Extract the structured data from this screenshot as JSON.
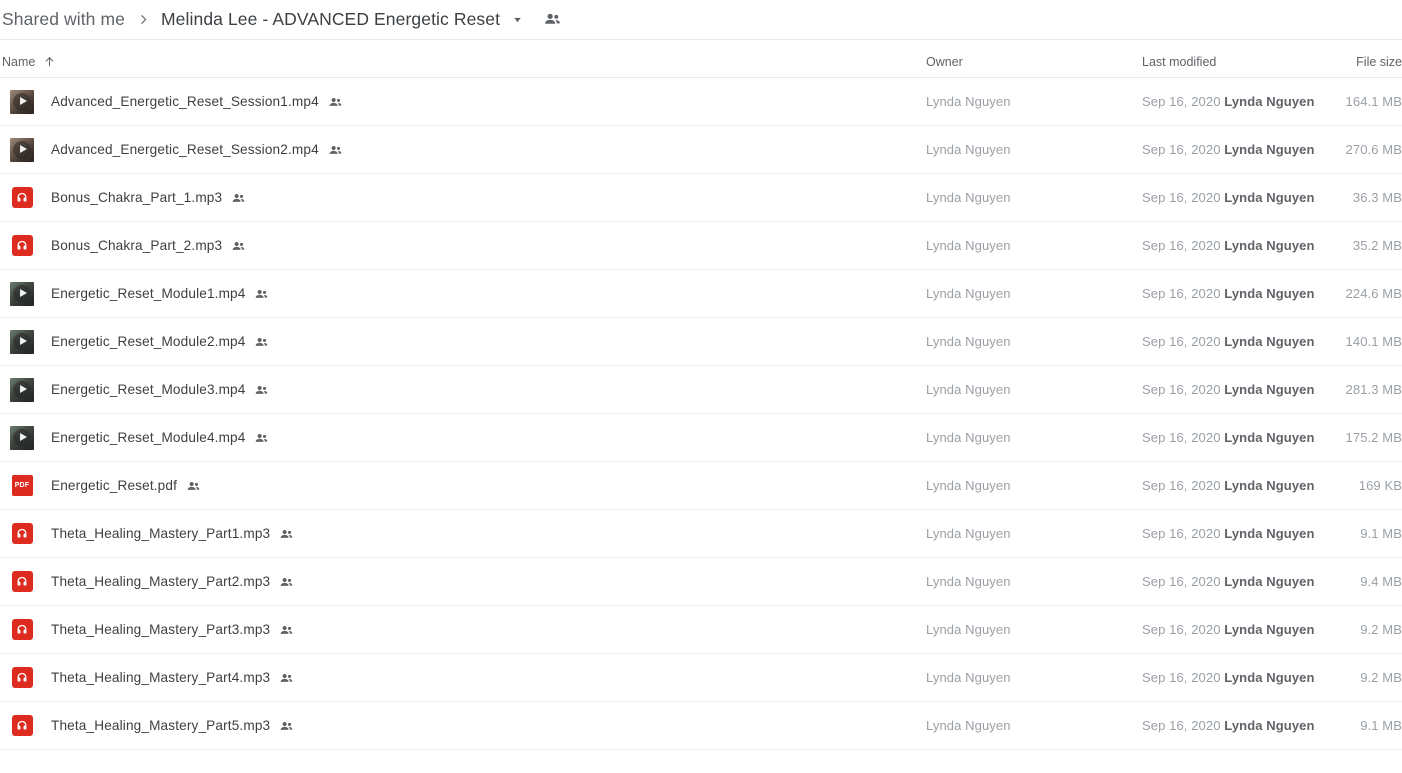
{
  "breadcrumb": {
    "root_label": "Shared with me",
    "separator": "›",
    "current_label": "Melinda Lee - ADVANCED Energetic Reset",
    "caret_icon": "chevron-down-icon",
    "people_icon": "people-icon"
  },
  "columns": {
    "name": "Name",
    "sort_icon": "arrow-up-icon",
    "owner": "Owner",
    "last_modified": "Last modified",
    "file_size": "File size"
  },
  "colors": {
    "accent_red": "#dd2c1f",
    "text_primary": "#3c4043",
    "text_secondary": "#5f6368",
    "text_muted": "#9aa0a6",
    "divider": "#e8eaed"
  },
  "files": [
    {
      "name": "Advanced_Energetic_Reset_Session1.mp4",
      "icon": "video-thumbnail-icon",
      "icon_variant": "warm",
      "shared_icon": "people-icon",
      "owner": "Lynda Nguyen",
      "modified_date": "Sep 16, 2020",
      "modified_by": "Lynda Nguyen",
      "size": "164.1 MB"
    },
    {
      "name": "Advanced_Energetic_Reset_Session2.mp4",
      "icon": "video-thumbnail-icon",
      "icon_variant": "warm",
      "shared_icon": "people-icon",
      "owner": "Lynda Nguyen",
      "modified_date": "Sep 16, 2020",
      "modified_by": "Lynda Nguyen",
      "size": "270.6 MB"
    },
    {
      "name": "Bonus_Chakra_Part_1.mp3",
      "icon": "audio-icon",
      "icon_variant": "audio",
      "shared_icon": "people-icon",
      "owner": "Lynda Nguyen",
      "modified_date": "Sep 16, 2020",
      "modified_by": "Lynda Nguyen",
      "size": "36.3 MB"
    },
    {
      "name": "Bonus_Chakra_Part_2.mp3",
      "icon": "audio-icon",
      "icon_variant": "audio",
      "shared_icon": "people-icon",
      "owner": "Lynda Nguyen",
      "modified_date": "Sep 16, 2020",
      "modified_by": "Lynda Nguyen",
      "size": "35.2 MB"
    },
    {
      "name": "Energetic_Reset_Module1.mp4",
      "icon": "video-thumbnail-icon",
      "icon_variant": "cool",
      "shared_icon": "people-icon",
      "owner": "Lynda Nguyen",
      "modified_date": "Sep 16, 2020",
      "modified_by": "Lynda Nguyen",
      "size": "224.6 MB"
    },
    {
      "name": "Energetic_Reset_Module2.mp4",
      "icon": "video-thumbnail-icon",
      "icon_variant": "cool",
      "shared_icon": "people-icon",
      "owner": "Lynda Nguyen",
      "modified_date": "Sep 16, 2020",
      "modified_by": "Lynda Nguyen",
      "size": "140.1 MB"
    },
    {
      "name": "Energetic_Reset_Module3.mp4",
      "icon": "video-thumbnail-icon",
      "icon_variant": "cool",
      "shared_icon": "people-icon",
      "owner": "Lynda Nguyen",
      "modified_date": "Sep 16, 2020",
      "modified_by": "Lynda Nguyen",
      "size": "281.3 MB"
    },
    {
      "name": "Energetic_Reset_Module4.mp4",
      "icon": "video-thumbnail-icon",
      "icon_variant": "cool",
      "shared_icon": "people-icon",
      "owner": "Lynda Nguyen",
      "modified_date": "Sep 16, 2020",
      "modified_by": "Lynda Nguyen",
      "size": "175.2 MB"
    },
    {
      "name": "Energetic_Reset.pdf",
      "icon": "pdf-icon",
      "icon_variant": "pdf",
      "icon_label": "PDF",
      "shared_icon": "people-icon",
      "owner": "Lynda Nguyen",
      "modified_date": "Sep 16, 2020",
      "modified_by": "Lynda Nguyen",
      "size": "169 KB"
    },
    {
      "name": "Theta_Healing_Mastery_Part1.mp3",
      "icon": "audio-icon",
      "icon_variant": "audio",
      "shared_icon": "people-icon",
      "owner": "Lynda Nguyen",
      "modified_date": "Sep 16, 2020",
      "modified_by": "Lynda Nguyen",
      "size": "9.1 MB"
    },
    {
      "name": "Theta_Healing_Mastery_Part2.mp3",
      "icon": "audio-icon",
      "icon_variant": "audio",
      "shared_icon": "people-icon",
      "owner": "Lynda Nguyen",
      "modified_date": "Sep 16, 2020",
      "modified_by": "Lynda Nguyen",
      "size": "9.4 MB"
    },
    {
      "name": "Theta_Healing_Mastery_Part3.mp3",
      "icon": "audio-icon",
      "icon_variant": "audio",
      "shared_icon": "people-icon",
      "owner": "Lynda Nguyen",
      "modified_date": "Sep 16, 2020",
      "modified_by": "Lynda Nguyen",
      "size": "9.2 MB"
    },
    {
      "name": "Theta_Healing_Mastery_Part4.mp3",
      "icon": "audio-icon",
      "icon_variant": "audio",
      "shared_icon": "people-icon",
      "owner": "Lynda Nguyen",
      "modified_date": "Sep 16, 2020",
      "modified_by": "Lynda Nguyen",
      "size": "9.2 MB"
    },
    {
      "name": "Theta_Healing_Mastery_Part5.mp3",
      "icon": "audio-icon",
      "icon_variant": "audio",
      "shared_icon": "people-icon",
      "owner": "Lynda Nguyen",
      "modified_date": "Sep 16, 2020",
      "modified_by": "Lynda Nguyen",
      "size": "9.1 MB"
    }
  ]
}
